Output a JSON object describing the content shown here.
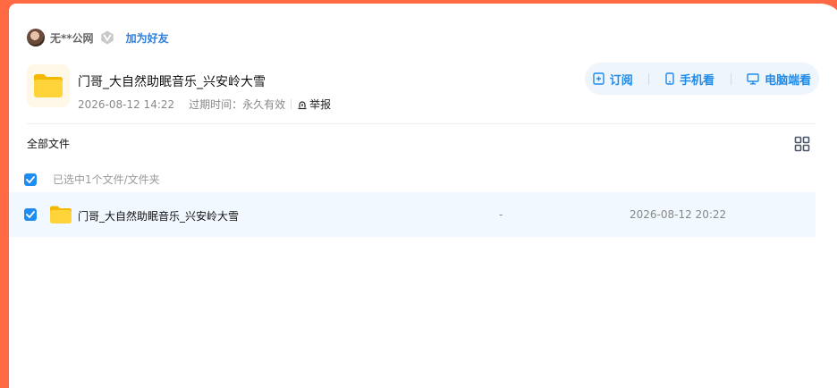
{
  "user": {
    "name": "无**公网",
    "add_friend_label": "加为好友"
  },
  "share": {
    "title": "门哥_大自然助眠音乐_兴安岭大雪",
    "created": "2026-08-12 14:22",
    "expiry_label": "过期时间：",
    "expiry_value": "永久有效",
    "report_label": "举报"
  },
  "actions": {
    "subscribe": "订阅",
    "mobile": "手机看",
    "desktop": "电脑端看"
  },
  "breadcrumb": "全部文件",
  "selection_text": "已选中1个文件/文件夹",
  "files": [
    {
      "name": "门哥_大自然助眠音乐_兴安岭大雪",
      "size": "-",
      "date": "2026-08-12 20:22",
      "selected": true
    }
  ],
  "colors": {
    "accent": "#1f8be8",
    "frame": "#ff6a45",
    "checkbox": "#1e8cf0",
    "row_selected": "#f2f8ff"
  }
}
